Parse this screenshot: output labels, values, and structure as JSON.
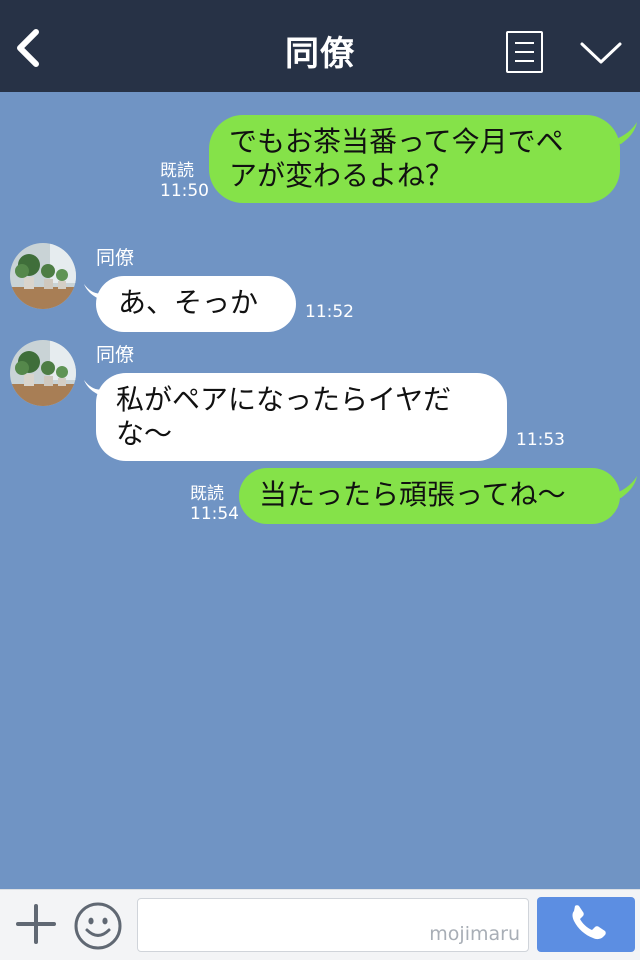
{
  "header": {
    "title": "同僚",
    "back_icon": "chevron-left-icon",
    "menu_icon": "list-icon",
    "expand_icon": "chevron-down-icon"
  },
  "colors": {
    "header_bg": "#273246",
    "chat_bg": "#7094c4",
    "outgoing_bubble": "#85e249",
    "incoming_bubble": "#ffffff",
    "call_button": "#5c8ee2"
  },
  "messages": [
    {
      "direction": "outgoing",
      "lines": [
        "でもお茶当番って今月でペ",
        "アが変わるよね？"
      ],
      "read_label": "既読",
      "time": "11:50"
    },
    {
      "direction": "incoming",
      "sender": "同僚",
      "lines": [
        "あ、そっか"
      ],
      "time": "11:52"
    },
    {
      "direction": "incoming",
      "sender": "同僚",
      "lines": [
        "私がペアになったらイヤだ",
        "な〜"
      ],
      "time": "11:53"
    },
    {
      "direction": "outgoing",
      "lines": [
        "当たったら頑張ってね〜"
      ],
      "read_label": "既読",
      "time": "11:54"
    }
  ],
  "input_bar": {
    "plus_icon": "plus-icon",
    "emoji_icon": "smiley-icon",
    "watermark": "mojimaru",
    "call_icon": "phone-icon"
  }
}
